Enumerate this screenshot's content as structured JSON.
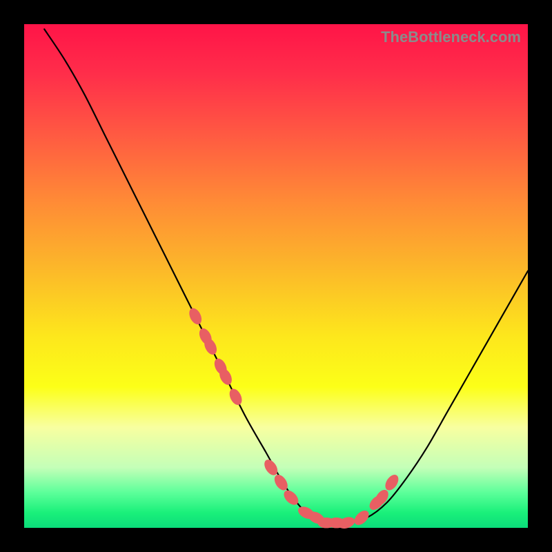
{
  "watermark": "TheBottleneck.com",
  "chart_data": {
    "type": "line",
    "title": "",
    "xlabel": "",
    "ylabel": "",
    "xlim": [
      0,
      100
    ],
    "ylim": [
      0,
      100
    ],
    "grid": false,
    "legend": false,
    "series": [
      {
        "name": "bottleneck-curve",
        "x": [
          4,
          8,
          12,
          16,
          20,
          24,
          28,
          32,
          36,
          40,
          44,
          48,
          52,
          56,
          60,
          64,
          68,
          72,
          76,
          80,
          84,
          88,
          92,
          96,
          100
        ],
        "y": [
          99,
          93,
          86,
          78,
          70,
          62,
          54,
          46,
          38,
          30,
          22,
          15,
          8,
          3,
          1,
          1,
          2,
          5,
          10,
          16,
          23,
          30,
          37,
          44,
          51
        ],
        "color": "#000000"
      }
    ],
    "markers": [
      {
        "name": "highlight-dots",
        "x": [
          34,
          36,
          37,
          39,
          40,
          42,
          49,
          51,
          53,
          56,
          58,
          60,
          62,
          64,
          67,
          70,
          71,
          73
        ],
        "y": [
          42,
          38,
          36,
          32,
          30,
          26,
          12,
          9,
          6,
          3,
          2,
          1,
          1,
          1,
          2,
          5,
          6,
          9
        ],
        "color": "#e85f63",
        "size": 14
      }
    ]
  }
}
